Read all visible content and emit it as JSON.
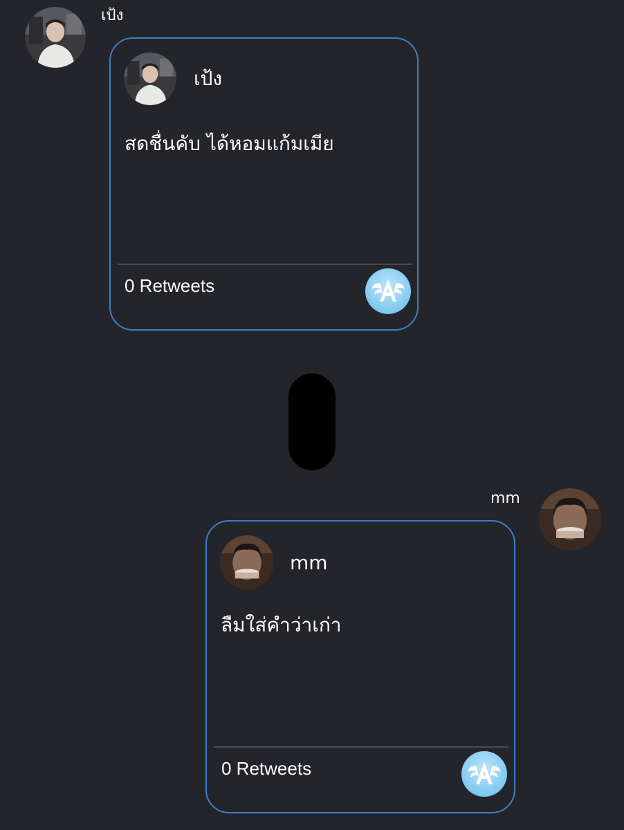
{
  "messages": [
    {
      "sender": "เป้ง",
      "card": {
        "name": "เป้ง",
        "text": "สดชื่นคับ ได้หอมแก้มเมีย",
        "retweets": "0 Retweets"
      },
      "avatar_icon": "person-photo-avatar",
      "badge_icon": "winged-a-app-icon"
    },
    {
      "sender": "mm",
      "card": {
        "name": "mm",
        "text": "ลืมใส่คำว่าเก่า",
        "retweets": "0 Retweets"
      },
      "avatar_icon": "person-photo-avatar",
      "badge_icon": "winged-a-app-icon"
    }
  ],
  "colors": {
    "background": "#24252b",
    "card_border": "#3d7fc4",
    "divider": "#4a4b52",
    "badge": "#7fc8f0",
    "text": "#ffffff"
  }
}
